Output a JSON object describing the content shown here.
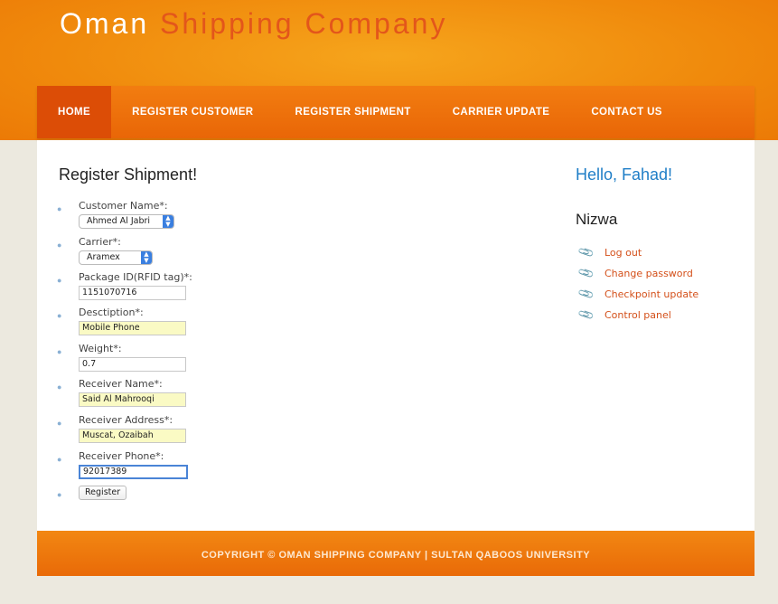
{
  "header": {
    "title_part1": "Oman",
    "title_part2": "Shipping Company"
  },
  "nav": {
    "items": [
      {
        "label": "HOME",
        "active": true
      },
      {
        "label": "REGISTER CUSTOMER"
      },
      {
        "label": "REGISTER SHIPMENT"
      },
      {
        "label": "CARRIER UPDATE"
      },
      {
        "label": "CONTACT US"
      }
    ]
  },
  "form": {
    "title": "Register Shipment!",
    "customer_name": {
      "label": "Customer Name*:",
      "value": "Ahmed Al Jabri"
    },
    "carrier": {
      "label": "Carrier*:",
      "value": "Aramex"
    },
    "package_id": {
      "label": "Package ID(RFID tag)*:",
      "value": "1151070716"
    },
    "description": {
      "label": "Desctiption*:",
      "value": "Mobile Phone"
    },
    "weight": {
      "label": "Weight*:",
      "value": "0.7"
    },
    "receiver_name": {
      "label": "Receiver Name*:",
      "value": "Said Al Mahrooqi"
    },
    "receiver_address": {
      "label": "Receiver Address*:",
      "value": "Muscat, Ozaibah"
    },
    "receiver_phone": {
      "label": "Receiver Phone*:",
      "value": "92017389"
    },
    "submit_label": "Register"
  },
  "sidebar": {
    "greeting": "Hello, Fahad!",
    "location": "Nizwa",
    "links": [
      {
        "label": "Log out"
      },
      {
        "label": "Change password"
      },
      {
        "label": "Checkpoint update"
      },
      {
        "label": "Control panel"
      }
    ]
  },
  "footer": {
    "text": "COPYRIGHT © OMAN SHIPPING COMPANY | SULTAN QABOOS UNIVERSITY"
  },
  "colors": {
    "brand_orange": "#f08a0c",
    "nav_active": "#dc4d06",
    "title_accent": "#e3561b",
    "link": "#d4501a",
    "greeting": "#1f7ec7"
  }
}
